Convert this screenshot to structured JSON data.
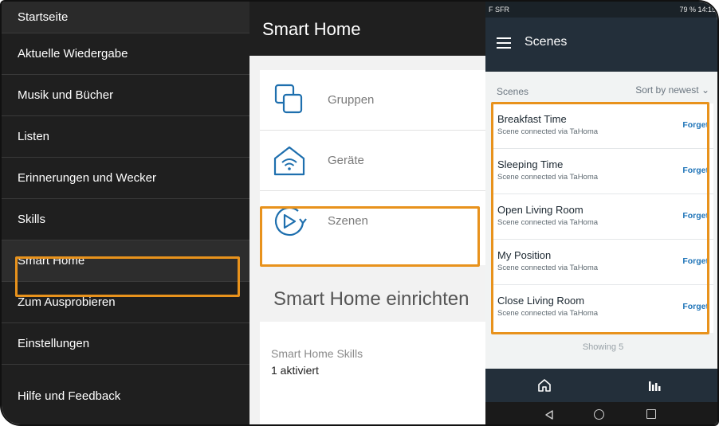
{
  "sidebar": {
    "items": [
      {
        "label": "Startseite"
      },
      {
        "label": "Aktuelle Wiedergabe"
      },
      {
        "label": "Musik und Bücher"
      },
      {
        "label": "Listen"
      },
      {
        "label": "Erinnerungen und Wecker"
      },
      {
        "label": "Skills"
      },
      {
        "label": "Smart Home"
      },
      {
        "label": "Zum Ausprobieren"
      },
      {
        "label": "Einstellungen"
      },
      {
        "label": "Hilfe und Feedback"
      }
    ],
    "active": "Smart Home"
  },
  "middle": {
    "title": "Smart Home",
    "rows": [
      {
        "label": "Gruppen",
        "icon": "groups-icon"
      },
      {
        "label": "Geräte",
        "icon": "devices-icon"
      },
      {
        "label": "Szenen",
        "icon": "scenes-icon"
      }
    ],
    "section_title": "Smart Home einrichten",
    "skills": {
      "label": "Smart Home Skills",
      "value": "1 aktiviert"
    }
  },
  "phone": {
    "status": {
      "left": "F SFR",
      "right": "79 % 14:15"
    },
    "app_title": "Scenes",
    "list_title": "Scenes",
    "sort_label": "Sort by newest",
    "scenes": [
      {
        "name": "Breakfast Time",
        "subtitle": "Scene connected via TaHoma",
        "action": "Forget"
      },
      {
        "name": "Sleeping Time",
        "subtitle": "Scene connected via TaHoma",
        "action": "Forget"
      },
      {
        "name": "Open Living Room",
        "subtitle": "Scene connected via TaHoma",
        "action": "Forget"
      },
      {
        "name": "My Position",
        "subtitle": "Scene connected via TaHoma",
        "action": "Forget"
      },
      {
        "name": "Close Living Room",
        "subtitle": "Scene connected via TaHoma",
        "action": "Forget"
      }
    ],
    "footer": "Showing 5"
  },
  "colors": {
    "highlight": "#e8921c",
    "sidebar_bg": "#1f1f1f",
    "app_bar": "#232f3a",
    "link": "#1f74b8",
    "icon_blue": "#1e6fae"
  }
}
